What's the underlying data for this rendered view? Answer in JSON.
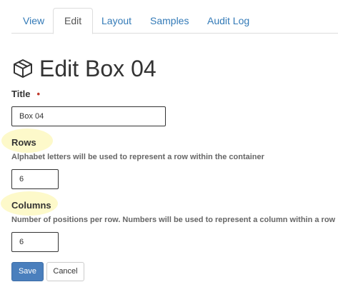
{
  "tabs": [
    {
      "label": "View",
      "active": false
    },
    {
      "label": "Edit",
      "active": true
    },
    {
      "label": "Layout",
      "active": false
    },
    {
      "label": "Samples",
      "active": false
    },
    {
      "label": "Audit Log",
      "active": false
    }
  ],
  "page": {
    "icon": "box-icon",
    "title": "Edit Box 04"
  },
  "form": {
    "title_field": {
      "label": "Title",
      "required_marker": "•",
      "value": "Box 04"
    },
    "rows_field": {
      "label": "Rows",
      "help": "Alphabet letters will be used to represent a row within the container",
      "value": "6"
    },
    "columns_field": {
      "label": "Columns",
      "help": "Number of positions per row. Numbers will be used to represent a column within a row",
      "value": "6"
    },
    "save_label": "Save",
    "cancel_label": "Cancel"
  },
  "colors": {
    "link": "#337ab7",
    "primary_button": "#4a7fbd",
    "highlight": "#fdf8c4",
    "required": "#c0392b"
  }
}
